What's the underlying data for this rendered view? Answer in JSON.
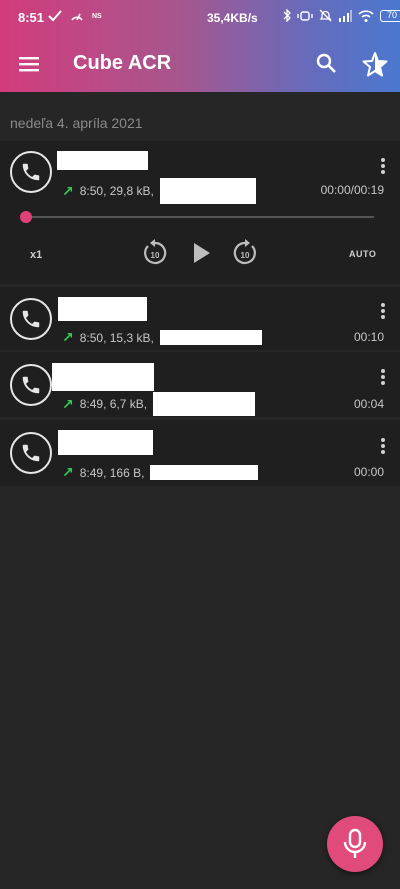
{
  "status_bar": {
    "time": "8:51",
    "network_label": "NS",
    "speed": "35,4KB/s",
    "battery": "70"
  },
  "toolbar": {
    "title": "Cube ACR",
    "icons": [
      "menu-icon",
      "search-icon",
      "star-icon"
    ]
  },
  "date_header": "nedeľa 4. apríla 2021",
  "recordings": [
    {
      "meta": "8:50, 29,8 kB,",
      "duration": "00:00/00:19",
      "direction": "outgoing",
      "expanded": true
    },
    {
      "meta": "8:50, 15,3 kB,",
      "duration": "00:10",
      "direction": "outgoing"
    },
    {
      "meta": "8:49, 6,7 kB,",
      "duration": "00:04",
      "direction": "outgoing"
    },
    {
      "meta": "8:49, 166 B,",
      "duration": "00:00",
      "direction": "outgoing"
    }
  ],
  "player": {
    "speed_label": "x1",
    "rewind_label": "10",
    "forward_label": "10",
    "auto_label": "AUTO",
    "progress": 0
  },
  "colors": {
    "accent": "#e04b7c",
    "outgoing_arrow": "#2fcf4e",
    "background": "#262626",
    "card": "#1f1f1f"
  }
}
